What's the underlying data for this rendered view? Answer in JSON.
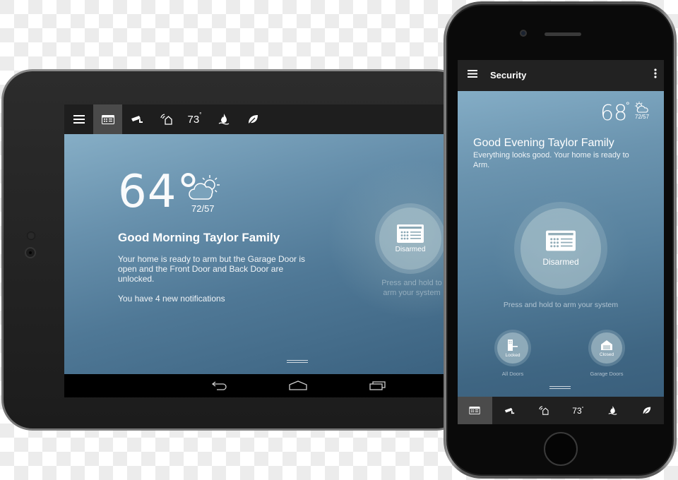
{
  "tablet": {
    "topbar": {
      "tabs": [
        {
          "icon": "hamburger-menu-icon",
          "active": false
        },
        {
          "icon": "keypad-security-icon",
          "active": true
        },
        {
          "icon": "security-camera-icon",
          "active": false
        },
        {
          "icon": "smart-home-icon",
          "active": false
        },
        {
          "icon": "thermostat-temp",
          "label": "73",
          "unit": "°",
          "active": false
        },
        {
          "icon": "water-fire-icon",
          "active": false
        },
        {
          "icon": "leaf-energy-icon",
          "active": false
        }
      ]
    },
    "weather": {
      "temperature": "64",
      "unit": "°",
      "condition_icon": "partly-cloudy-icon",
      "high_low": "72/57"
    },
    "greeting": "Good Morning Taylor Family",
    "message": "Your home is ready to arm but the Garage Door is open and the Front Door and Back Door are unlocked.",
    "notifications": "You have 4 new notifications",
    "arm_button": {
      "status": "Disarmed",
      "icon": "keypad-icon"
    },
    "arm_hint": "Press and hold to arm your system",
    "navbar": [
      "back-icon",
      "home-icon",
      "recent-apps-icon"
    ]
  },
  "phone": {
    "appbar": {
      "title": "Security",
      "menu_icon": "hamburger-menu-icon",
      "more_icon": "overflow-menu-icon"
    },
    "weather": {
      "temperature": "68",
      "unit": "°",
      "condition_icon": "partly-cloudy-icon",
      "high_low": "72/57"
    },
    "greeting": "Good Evening Taylor Family",
    "message": "Everything looks good. Your home is ready to Arm.",
    "arm_button": {
      "status": "Disarmed",
      "icon": "keypad-icon"
    },
    "arm_hint": "Press and hold to arm your system",
    "devices": [
      {
        "label": "All Doors",
        "state": "Locked",
        "icon": "door-lock-icon"
      },
      {
        "label": "Garage Doors",
        "state": "Closed",
        "icon": "garage-icon"
      }
    ],
    "tabbar": [
      {
        "icon": "keypad-security-icon",
        "active": true
      },
      {
        "icon": "security-camera-icon",
        "active": false
      },
      {
        "icon": "smart-home-icon",
        "active": false
      },
      {
        "icon": "thermostat-temp",
        "label": "73",
        "unit": "°",
        "active": false
      },
      {
        "icon": "water-fire-icon",
        "active": false
      },
      {
        "icon": "leaf-energy-icon",
        "active": false
      }
    ]
  }
}
